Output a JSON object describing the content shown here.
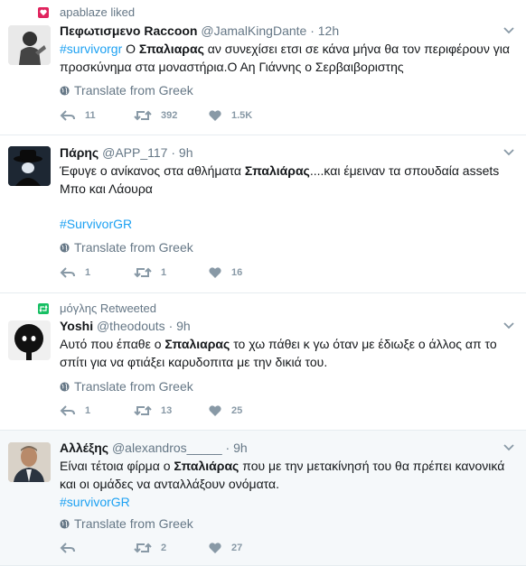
{
  "tweets": [
    {
      "context": {
        "type": "like",
        "text": "apablaze liked"
      },
      "fullname": "Πεφωτισμενο Raccoon",
      "handle": "@JamalKingDante",
      "dot": "·",
      "time": "12h",
      "parts": [
        {
          "text": "#survivorgr",
          "style": "hashtag"
        },
        {
          "text": " Ο ",
          "style": ""
        },
        {
          "text": "Σπαλιαρας",
          "style": "bold"
        },
        {
          "text": " αν συνεχίσει ετσι σε κάνα μήνα θα τον περιφέρουν για προσκύνημα στα μοναστήρια.Ο Αη Γιάννης ο Σερβαιβοριστης",
          "style": ""
        }
      ],
      "translate": "Translate from Greek",
      "replies": "11",
      "retweets": "392",
      "likes": "1.5K"
    },
    {
      "context": null,
      "fullname": "Πάρης",
      "handle": "@APP_117",
      "dot": "·",
      "time": "9h",
      "parts": [
        {
          "text": "Έφυγε ο ανίκανος στα αθλήματα ",
          "style": ""
        },
        {
          "text": "Σπαλιάρας",
          "style": "bold"
        },
        {
          "text": "....και έμειναν τα σπουδαία assets Μπο και Λάουρα",
          "style": ""
        }
      ],
      "extra_hashtag": "#SurvivorGR",
      "translate": "Translate from Greek",
      "replies": "1",
      "retweets": "1",
      "likes": "16"
    },
    {
      "context": {
        "type": "retweet",
        "text": "μόγλης Retweeted"
      },
      "fullname": "Yoshi",
      "handle": "@theodouts",
      "dot": "·",
      "time": "9h",
      "parts": [
        {
          "text": "Αυτό που έπαθε ο ",
          "style": ""
        },
        {
          "text": "Σπαλιαρας",
          "style": "bold"
        },
        {
          "text": " το χω πάθει κ γω όταν με έδιωξε ο άλλος απ το σπίτι για να φτιάξει καρυδοπιτα με την δικιά του.",
          "style": ""
        }
      ],
      "translate": "Translate from Greek",
      "replies": "1",
      "retweets": "13",
      "likes": "25"
    },
    {
      "context": null,
      "fullname": "Αλλέξης",
      "handle": "@alexandros_____",
      "dot": "·",
      "time": "9h",
      "parts": [
        {
          "text": "Είναι τέτοια φίρμα ο ",
          "style": ""
        },
        {
          "text": "Σπαλιάρας",
          "style": "bold"
        },
        {
          "text": " που με την μετακίνησή του θα πρέπει κανονικά και οι ομάδες να ανταλλάξουν ονόματα.",
          "style": ""
        }
      ],
      "extra_hashtag": "#survivorGR",
      "translate": "Translate from Greek",
      "replies": "",
      "retweets": "2",
      "likes": "27"
    }
  ],
  "colors": {
    "like": "#e0245e",
    "retweet": "#17bf63",
    "hashtag": "#1da1f2",
    "muted": "#657786",
    "alt_bg": "#f5f8fa"
  },
  "icons": [
    "heart-icon",
    "retweet-icon",
    "globe-icon",
    "reply-icon",
    "chevron-down-icon"
  ]
}
